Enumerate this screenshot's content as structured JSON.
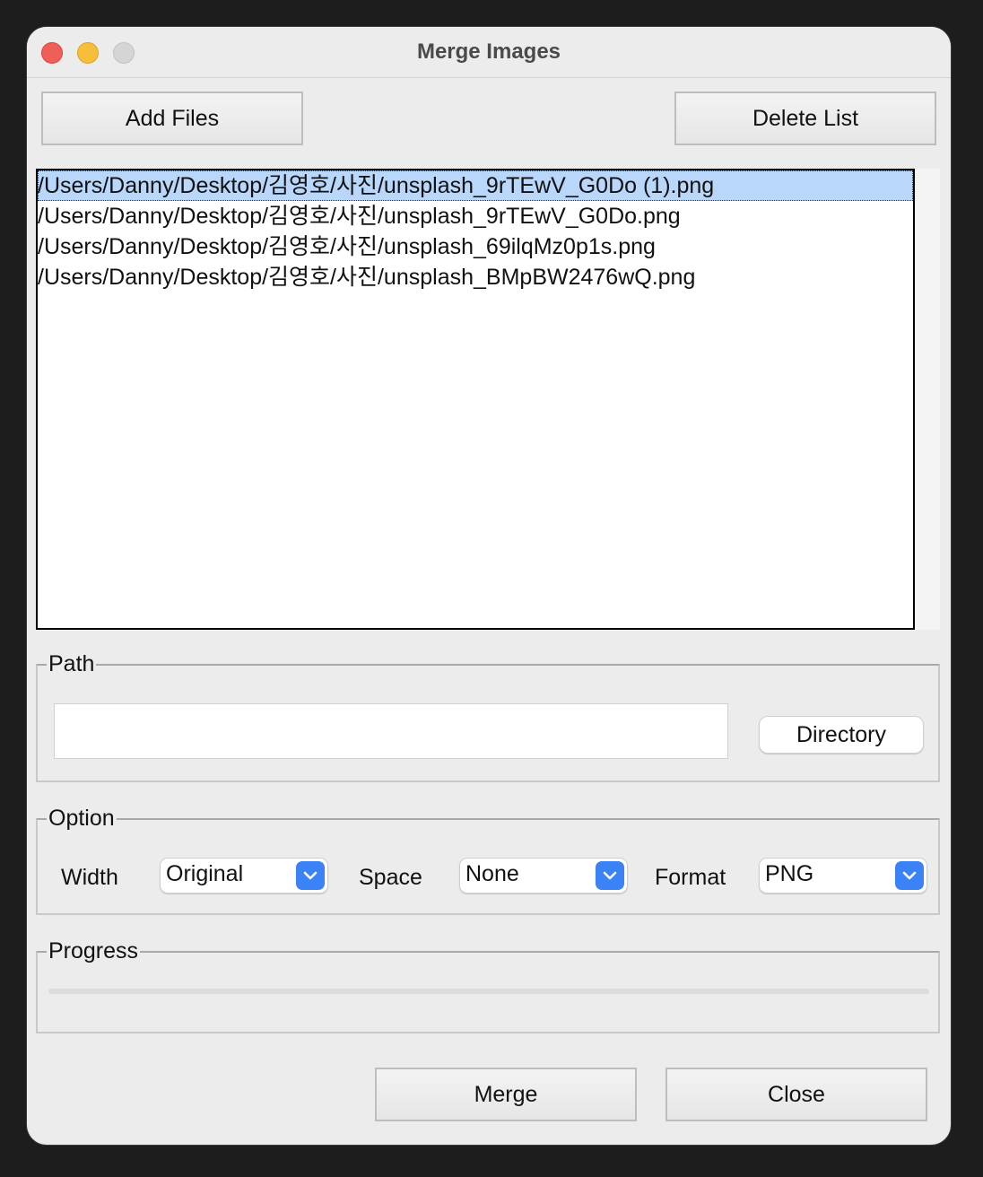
{
  "window": {
    "title": "Merge Images"
  },
  "toolbar": {
    "add_files_label": "Add Files",
    "delete_list_label": "Delete List"
  },
  "file_list": {
    "items": [
      "/Users/Danny/Desktop/김영호/사진/unsplash_9rTEwV_G0Do (1).png",
      "/Users/Danny/Desktop/김영호/사진/unsplash_9rTEwV_G0Do.png",
      "/Users/Danny/Desktop/김영호/사진/unsplash_69ilqMz0p1s.png",
      "/Users/Danny/Desktop/김영호/사진/unsplash_BMpBW2476wQ.png"
    ],
    "selected_index": 0
  },
  "path": {
    "label": "Path",
    "value": "",
    "directory_button": "Directory"
  },
  "option": {
    "label": "Option",
    "width": {
      "label": "Width",
      "value": "Original"
    },
    "space": {
      "label": "Space",
      "value": "None"
    },
    "format": {
      "label": "Format",
      "value": "PNG"
    }
  },
  "progress": {
    "label": "Progress",
    "value": 0
  },
  "actions": {
    "merge_label": "Merge",
    "close_label": "Close"
  },
  "colors": {
    "accent": "#3b82f6",
    "selection": "#b9d6fb"
  }
}
